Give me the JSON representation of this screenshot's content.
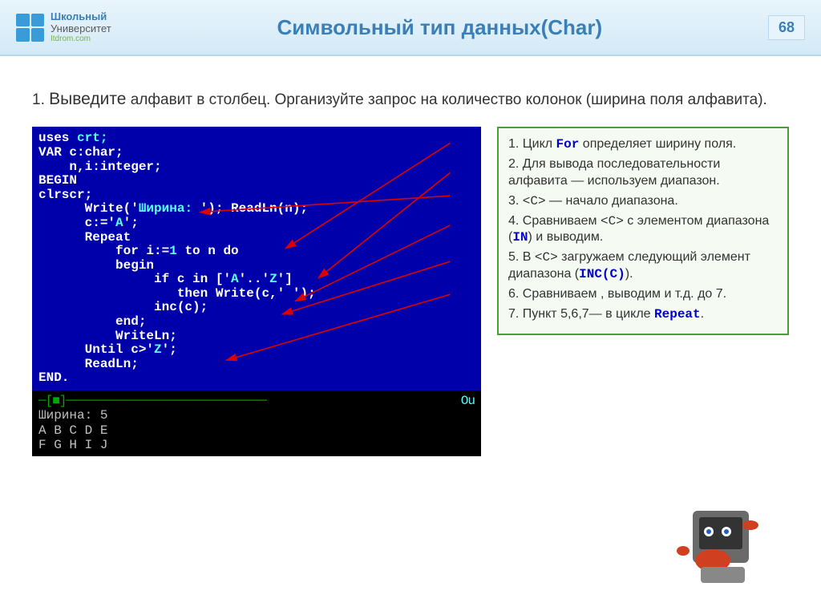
{
  "header": {
    "logo_top": "Школьный",
    "logo_bottom": "Университет",
    "logo_sub": "Itdrom.com",
    "title": "Символьный тип данных(Char)",
    "page": "68"
  },
  "task": {
    "num": "1.",
    "lead": "Выведите",
    "rest": " алфавит в столбец. Организуйте запрос на количество колонок (ширина поля алфавита)."
  },
  "code": {
    "l1a": "uses ",
    "l1b": "crt;",
    "l2": "VAR c:char;",
    "l3": "    n,i:integer;",
    "l4": "BEGIN",
    "l5": "clrscr;",
    "l6a": "      Write('",
    "l6b": "Ширина: ",
    "l6c": "'); ReadLn(n);",
    "l7a": "      c:='",
    "l7b": "A",
    "l7c": "';",
    "l8": "      Repeat",
    "l9a": "          for i:=",
    "l9b": "1",
    "l9c": " to n do",
    "l10": "          begin",
    "l11a": "               if c in ['",
    "l11b": "A",
    "l11c": "'..'",
    "l11d": "Z",
    "l11e": "']",
    "l12a": "                  then Write(c,'",
    "l12b": " ",
    "l12c": "');",
    "l13": "               inc(c);",
    "l14": "          end;",
    "l15": "          WriteLn;",
    "l16a": "      Until c>'",
    "l16b": "Z",
    "l16c": "';",
    "l17": "      ReadLn;",
    "l18": "END."
  },
  "output": {
    "sep_l": "─[■]─────────────────────────────",
    "sep_r": " Ou",
    "l1": "Ширина: 5",
    "l2": "A B C D E",
    "l3": "F G H I J"
  },
  "notes": {
    "n1a": "1. Цикл ",
    "n1b": "For",
    "n1c": " определяет  ширину поля.",
    "n2": "2. Для вывода последовательности алфавита — используем  диапазон.",
    "n3a": "3. ",
    "n3b": "<С>",
    "n3c": " — начало диапазона.",
    "n4a": "4. Сравниваем ",
    "n4b": "<С>",
    "n4c": " с  элементом диапазона (",
    "n4d": "IN",
    "n4e": ") и выводим.",
    "n5a": "5. В ",
    "n5b": "<С>",
    "n5c": " загружаем следующий элемент диапазона (",
    "n5d": "INC(C)",
    "n5e": ").",
    "n6": "6. Сравниваем , выводим и т.д. до 7.",
    "n7a": "7. Пункт 5,6,7— в цикле ",
    "n7b": "Repeat",
    "n7c": "."
  }
}
